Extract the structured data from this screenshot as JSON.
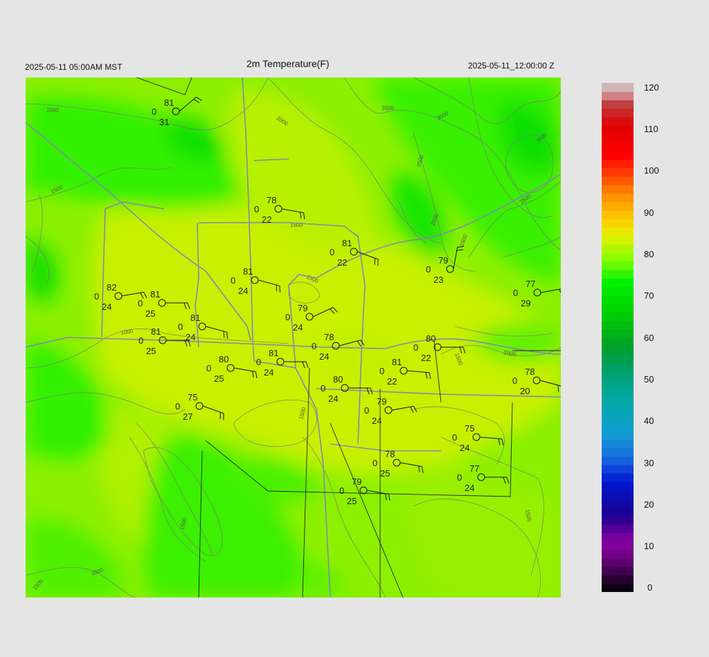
{
  "header": {
    "valid_local": "2025-05-11 05:00AM MST",
    "title": "2m Temperature(F)",
    "valid_utc": "2025-05-11_12:00:00 Z"
  },
  "colorbar": {
    "labels": [
      "120",
      "110",
      "100",
      "90",
      "80",
      "70",
      "60",
      "50",
      "40",
      "30",
      "20",
      "10",
      "0"
    ],
    "stops": [
      {
        "v": 0,
        "c": "#000000"
      },
      {
        "v": 8,
        "c": "#6a0080"
      },
      {
        "v": 12,
        "c": "#8a00a0"
      },
      {
        "v": 18,
        "c": "#1a0090"
      },
      {
        "v": 26,
        "c": "#0018d0"
      },
      {
        "v": 32,
        "c": "#1a6ee0"
      },
      {
        "v": 38,
        "c": "#10a0d0"
      },
      {
        "v": 46,
        "c": "#00a8a0"
      },
      {
        "v": 52,
        "c": "#00a070"
      },
      {
        "v": 58,
        "c": "#00a028"
      },
      {
        "v": 66,
        "c": "#00d000"
      },
      {
        "v": 73,
        "c": "#00f000"
      },
      {
        "v": 78,
        "c": "#7cff00"
      },
      {
        "v": 84,
        "c": "#e6f000"
      },
      {
        "v": 89,
        "c": "#ffc000"
      },
      {
        "v": 94,
        "c": "#ff8800"
      },
      {
        "v": 98,
        "c": "#ff4800"
      },
      {
        "v": 103,
        "c": "#ff0000"
      },
      {
        "v": 110,
        "c": "#e00000"
      },
      {
        "v": 115,
        "c": "#c04040"
      },
      {
        "v": 118,
        "c": "#d8a0a8"
      },
      {
        "v": 120,
        "c": "#c8c8c8"
      }
    ]
  },
  "contours": [
    "2000",
    "2000",
    "3500",
    "3000",
    "3500",
    "2500",
    "2000",
    "1500",
    "2500",
    "1500",
    "1500",
    "1500",
    "1000",
    "2000",
    "1500",
    "1500",
    "1500",
    "1500",
    "1500",
    "1500"
  ],
  "stations": [
    {
      "t": "81",
      "d": "31",
      "z": "0"
    },
    {
      "t": "78",
      "d": "22",
      "z": "0"
    },
    {
      "t": "81",
      "d": "22",
      "z": "0"
    },
    {
      "t": "79",
      "d": "23",
      "z": "0"
    },
    {
      "t": "81",
      "d": "24",
      "z": "0"
    },
    {
      "t": "82",
      "d": "24",
      "z": "0"
    },
    {
      "t": "81",
      "d": "25",
      "z": "0"
    },
    {
      "t": "77",
      "d": "29",
      "z": "0"
    },
    {
      "t": "79",
      "d": "24",
      "z": "0"
    },
    {
      "t": "81",
      "d": "24",
      "z": "0"
    },
    {
      "t": "78",
      "d": "24",
      "z": "0"
    },
    {
      "t": "81",
      "d": "25",
      "z": "0"
    },
    {
      "t": "80",
      "d": "22",
      "z": "0"
    },
    {
      "t": "81",
      "d": "24",
      "z": "0"
    },
    {
      "t": "80",
      "d": "25",
      "z": "0"
    },
    {
      "t": "81",
      "d": "22",
      "z": "0"
    },
    {
      "t": "78",
      "d": "20",
      "z": "0"
    },
    {
      "t": "80",
      "d": "24",
      "z": "0"
    },
    {
      "t": "75",
      "d": "27",
      "z": "0"
    },
    {
      "t": "79",
      "d": "24",
      "z": "0"
    },
    {
      "t": "75",
      "d": "24",
      "z": "0"
    },
    {
      "t": "78",
      "d": "25",
      "z": "0"
    },
    {
      "t": "77",
      "d": "24",
      "z": "0"
    },
    {
      "t": "79",
      "d": "25",
      "z": "0"
    }
  ]
}
